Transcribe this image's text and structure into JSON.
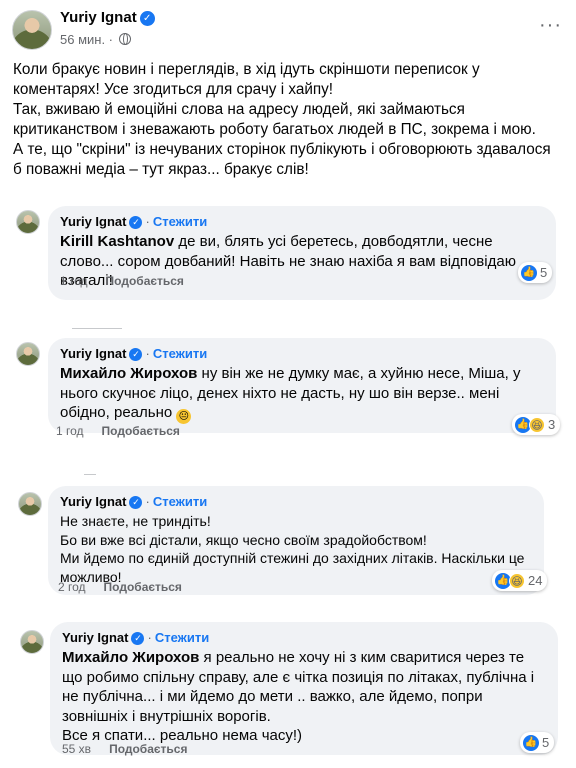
{
  "post": {
    "author": "Yuriy Ignat",
    "time": "56 мин.",
    "more_icon": "···",
    "paragraphs": [
      "Коли бракує новин і переглядів, в хід ідуть скріншоти переписок у коментарях! Усе згодиться для срачу і хайпу!",
      "Так, вживаю й емоційні слова на адресу людей, які займаються критиканством і зневажають роботу багатьох людей в ПС, зокрема і мою.",
      "А те, що \"скріни\" із нечуваних сторінок публікують і обговорюють здавалося б поважні медіа – тут якраз... бракує слів!"
    ]
  },
  "ui": {
    "follow": "Стежити",
    "like": "Подобається"
  },
  "comments": [
    {
      "author": "Yuriy Ignat",
      "mention": "Kirill Kashtanov",
      "text": " де ви, блять усі беретесь, довбодятли, чесне слово... сором довбаний! Навіть не знаю нахіба я вам відповідаю взагалі!",
      "time": "1 год",
      "reaction_count": "5"
    },
    {
      "author": "Yuriy Ignat",
      "mention": "Михайло Жирохов",
      "text": " ну він же не думку має, а хуйню несе, Міша, у нього скучноє ліцо, денех ніхто не дасть, ну шо він верзе.. мені обідно, реально ",
      "emoji": "😐",
      "time": "1 год",
      "reaction_count": "3"
    },
    {
      "author": "Yuriy Ignat",
      "lines": [
        "Не знаєте, не триндіть!",
        "Бо ви вже всі дістали, якщо чесно своїм зрадойобством!",
        "Ми йдемо по єдиній доступній стежині до західних літаків. Наскільки це можливо!"
      ],
      "time": "2 год",
      "reaction_count": "24"
    },
    {
      "author": "Yuriy Ignat",
      "mention": "Михайло Жирохов",
      "text": " я реально не хочу ні з ким сваритися через те що робимо спільну справу, але є чітка позиція по літаках, публічна і не публічна... і ми йдемо до мети .. важко, але йдемо, попри зовнішніх і внутрішніх ворогів.",
      "text2": "Все я спати... реально нема часу!)",
      "time": "55 хв",
      "reaction_count": "5"
    }
  ]
}
